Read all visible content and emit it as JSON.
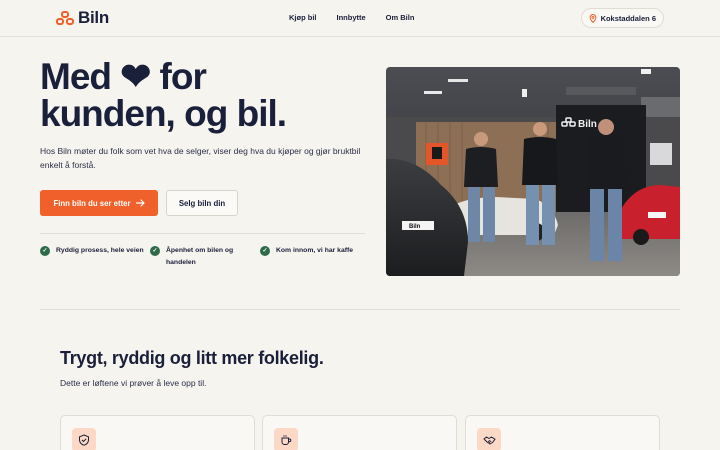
{
  "brand": {
    "name": "Biln",
    "accent": "#f0602a",
    "dark": "#1a1f3a"
  },
  "nav": {
    "links": [
      "Kjøp bil",
      "Innbytte",
      "Om Biln"
    ],
    "location": "Kokstaddalen 6"
  },
  "hero": {
    "title_line1": "Med ❤ for",
    "title_line2": "kunden, og bil.",
    "description": "Hos Biln møter du folk som vet hva de selger, viser deg hva du kjøper og gjør bruktbil enkelt å forstå.",
    "primary_button": "Finn biln du ser etter",
    "secondary_button": "Selg biln din",
    "features": [
      "Ryddig prosess, hele veien",
      "Åpenhet om bilen og handelen",
      "Kom innom, vi har kaffe"
    ],
    "photo_alt": "Tre ansatte i Biln-showroomet foran biler",
    "photo_signs": {
      "wall_logo": "Biln",
      "plate": "Biln"
    }
  },
  "promise": {
    "title": "Trygt, ryddig og litt mer folkelig.",
    "subtitle": "Dette er løftene vi prøver å leve opp til.",
    "cards": [
      {
        "icon": "shield-icon"
      },
      {
        "icon": "coffee-cup-icon"
      },
      {
        "icon": "handshake-icon"
      }
    ]
  }
}
